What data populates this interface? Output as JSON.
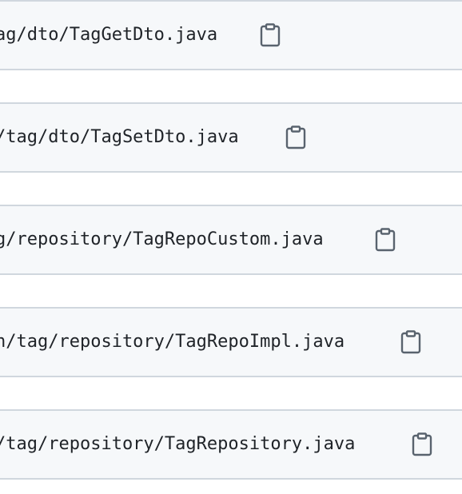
{
  "files": [
    {
      "path": "ag/dto/TagGetDto.java",
      "icon": "clipboard-icon"
    },
    {
      "path": "/tag/dto/TagSetDto.java",
      "icon": "clipboard-icon"
    },
    {
      "path": "g/repository/TagRepoCustom.java",
      "icon": "clipboard-icon"
    },
    {
      "path": "n/tag/repository/TagRepoImpl.java",
      "icon": "clipboard-icon"
    },
    {
      "path": "/tag/repository/TagRepository.java",
      "icon": "clipboard-icon"
    }
  ],
  "colors": {
    "header_bg": "#f6f8fa",
    "border": "#d0d7de",
    "text": "#1f2328",
    "icon": "#59636e"
  }
}
